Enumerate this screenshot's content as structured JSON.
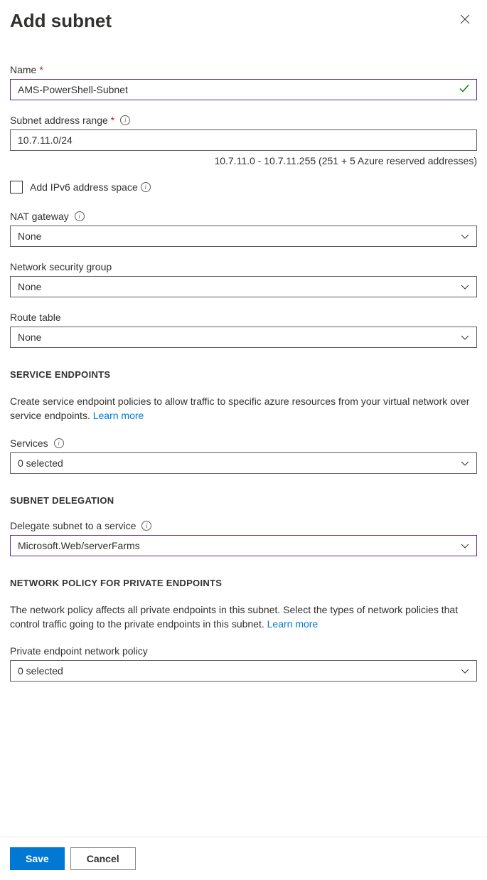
{
  "header": {
    "title": "Add subnet"
  },
  "fields": {
    "name": {
      "label": "Name",
      "value": "AMS-PowerShell-Subnet"
    },
    "address_range": {
      "label": "Subnet address range",
      "value": "10.7.11.0/24",
      "helper": "10.7.11.0 - 10.7.11.255 (251 + 5 Azure reserved addresses)"
    },
    "ipv6": {
      "label": "Add IPv6 address space"
    },
    "nat_gateway": {
      "label": "NAT gateway",
      "value": "None"
    },
    "nsg": {
      "label": "Network security group",
      "value": "None"
    },
    "route_table": {
      "label": "Route table",
      "value": "None"
    }
  },
  "service_endpoints": {
    "heading": "SERVICE ENDPOINTS",
    "description": "Create service endpoint policies to allow traffic to specific azure resources from your virtual network over service endpoints. ",
    "learn_more": "Learn more",
    "services": {
      "label": "Services",
      "value": "0 selected"
    }
  },
  "subnet_delegation": {
    "heading": "SUBNET DELEGATION",
    "delegate": {
      "label": "Delegate subnet to a service",
      "value": "Microsoft.Web/serverFarms"
    }
  },
  "network_policy": {
    "heading": "NETWORK POLICY FOR PRIVATE ENDPOINTS",
    "description": "The network policy affects all private endpoints in this subnet. Select the types of network policies that control traffic going to the private endpoints in this subnet. ",
    "learn_more": "Learn more",
    "private_endpoint": {
      "label": "Private endpoint network policy",
      "value": "0 selected"
    }
  },
  "footer": {
    "save": "Save",
    "cancel": "Cancel"
  }
}
